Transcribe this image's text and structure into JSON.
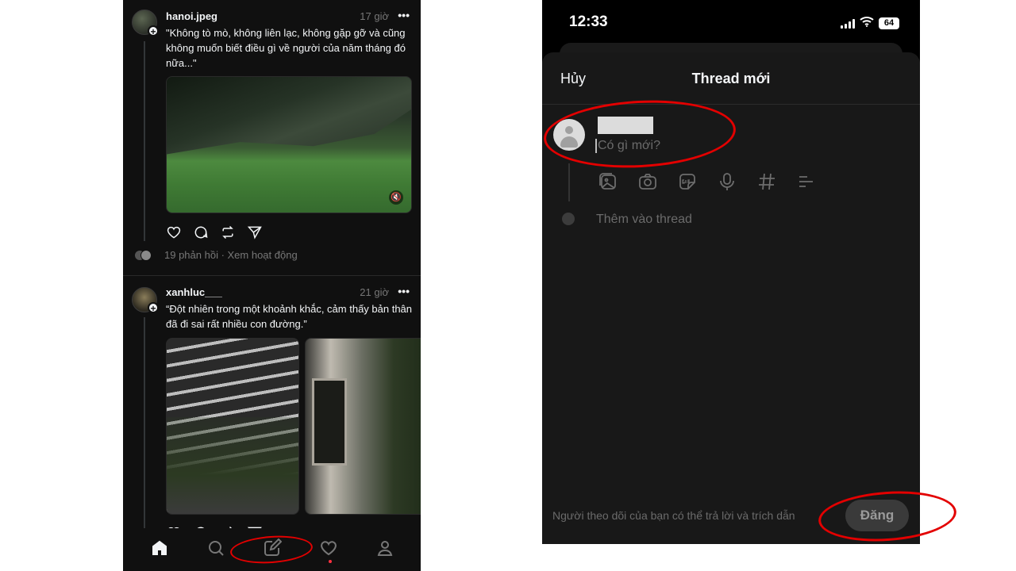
{
  "feed": {
    "posts": [
      {
        "username": "hanoi.jpeg",
        "time": "17 giờ",
        "text": "\"Không tò mò, không liên lạc, không gặp gỡ và cũng không muốn biết điều gì về người của năm tháng đó nữa...\"",
        "replies": "19 phản hồi · Xem hoạt động"
      },
      {
        "username": "xanhluc___",
        "time": "21 giờ",
        "text": "“Đột nhiên trong một khoảnh khắc, cảm thấy bản thân đã đi sai rất nhiều con đường.”"
      }
    ],
    "more_symbol": "•••",
    "plus_symbol": "+",
    "mute_symbol": "🔇",
    "bottom_nav": [
      "home-icon",
      "search-icon",
      "compose-icon",
      "heart-icon",
      "profile-icon"
    ],
    "notification_color": "#ff3040"
  },
  "composer": {
    "status_time": "12:33",
    "battery": "64",
    "cancel": "Hủy",
    "title": "Thread mới",
    "placeholder": "Có gì mới?",
    "toolbar": [
      "gallery-icon",
      "camera-icon",
      "gif-icon",
      "microphone-icon",
      "hashtag-icon",
      "poll-icon"
    ],
    "add_to_thread": "Thêm vào thread",
    "footer_note": "Người theo dõi của bạn có thể trả lời và trích dẫn",
    "post_button": "Đăng"
  },
  "annotation_color": "#e30000"
}
